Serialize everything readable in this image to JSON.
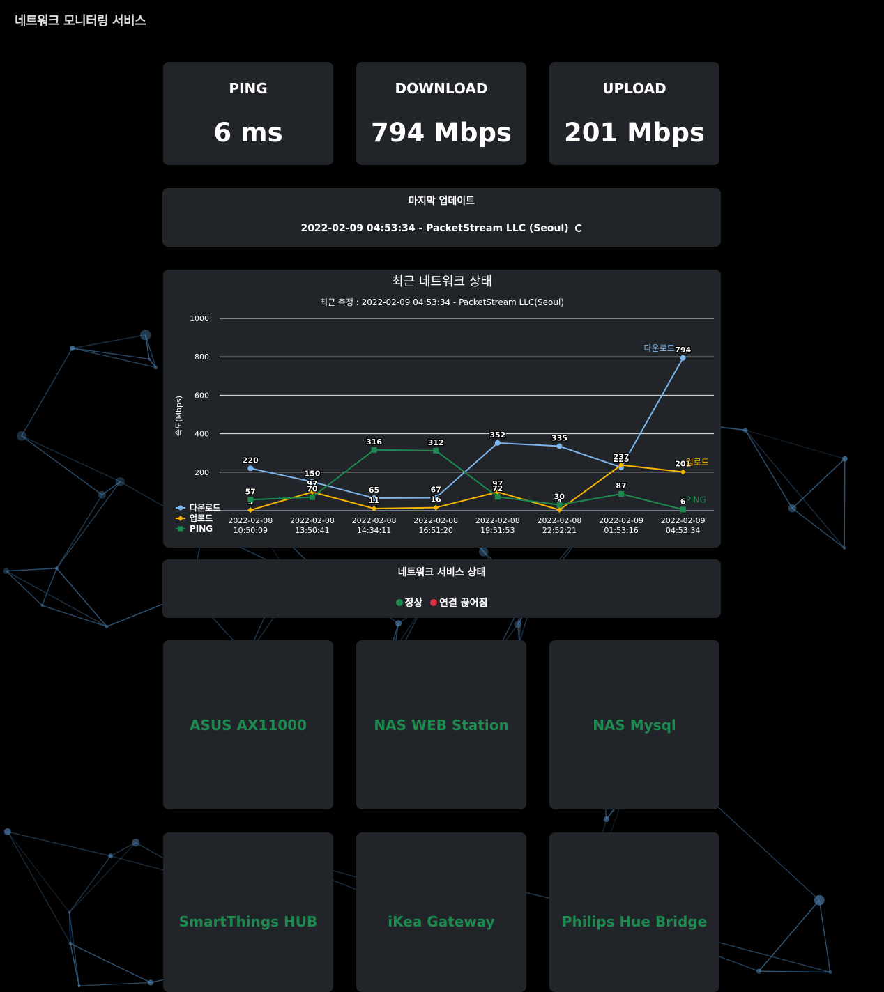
{
  "app_title": "네트워크 모니터링 서비스",
  "stats": [
    {
      "label": "PING",
      "value": "6 ms"
    },
    {
      "label": "DOWNLOAD",
      "value": "794 Mbps"
    },
    {
      "label": "UPLOAD",
      "value": "201 Mbps"
    }
  ],
  "last_update": {
    "heading": "마지막 업데이트",
    "text": "2022-02-09 04:53:34 - PacketStream LLC (Seoul)"
  },
  "chart_data": {
    "type": "line",
    "title": "최근 네트워크 상태",
    "subtitle": "최근 측정 : 2022-02-09 04:53:34 - PacketStream LLC(Seoul)",
    "ylabel": "속도(Mbps)",
    "ylim": [
      0,
      1000
    ],
    "yticks": [
      "1000",
      "800",
      "600",
      "400",
      "200"
    ],
    "grid": true,
    "legend_position": "bottom-left",
    "categories": [
      [
        "2022-02-08",
        "10:50:09"
      ],
      [
        "2022-02-08",
        "13:50:41"
      ],
      [
        "2022-02-08",
        "14:34:11"
      ],
      [
        "2022-02-08",
        "16:51:20"
      ],
      [
        "2022-02-08",
        "19:51:53"
      ],
      [
        "2022-02-08",
        "22:52:21"
      ],
      [
        "2022-02-09",
        "01:53:16"
      ],
      [
        "2022-02-09",
        "04:53:34"
      ]
    ],
    "series": [
      {
        "name": "다운로드",
        "color": "#7cb5ec",
        "marker": "circle",
        "values": [
          220,
          150,
          65,
          67,
          352,
          335,
          225,
          794
        ]
      },
      {
        "name": "업로드",
        "color": "#f7b500",
        "marker": "diamond",
        "values": [
          3,
          97,
          11,
          16,
          97,
          4,
          237,
          201
        ]
      },
      {
        "name": "PING",
        "color": "#1e8a4f",
        "marker": "square",
        "values": [
          57,
          70,
          316,
          312,
          72,
          30,
          87,
          6
        ]
      }
    ]
  },
  "service_status": {
    "heading": "네트워크 서비스 상태",
    "normal_label": "정상",
    "disconnected_label": "연결 끊어짐",
    "normal_color": "#1e8a4f",
    "disconnected_color": "#dc3545"
  },
  "services": [
    {
      "name": "ASUS AX11000"
    },
    {
      "name": "NAS WEB Station"
    },
    {
      "name": "NAS Mysql"
    },
    {
      "name": "SmartThings HUB"
    },
    {
      "name": "iKea Gateway"
    },
    {
      "name": "Philips Hue Bridge"
    }
  ]
}
